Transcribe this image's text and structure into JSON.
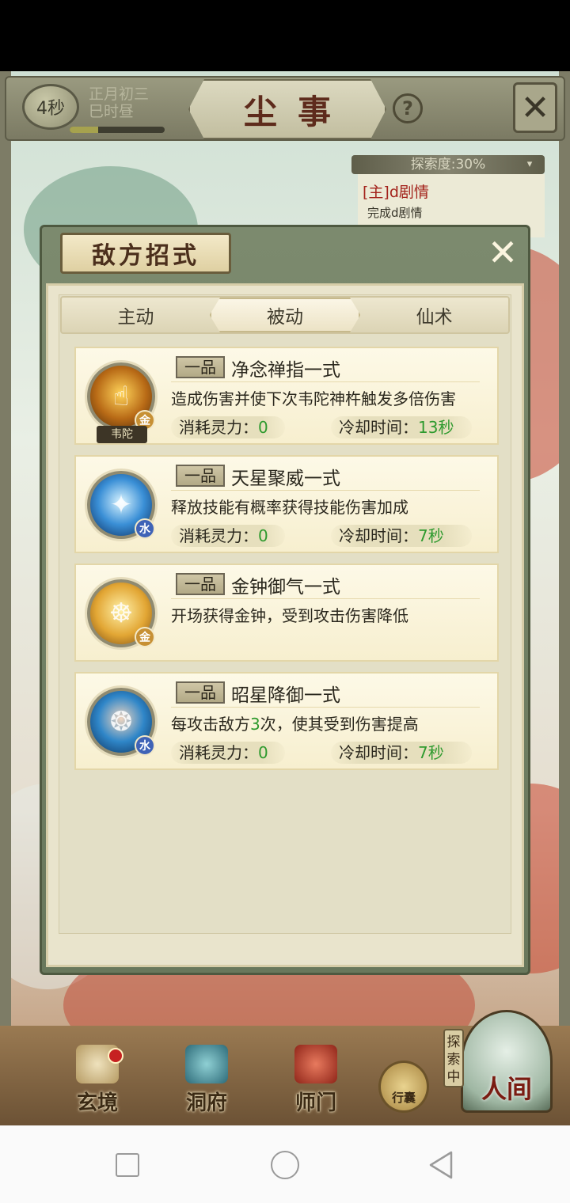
{
  "header": {
    "timer": "4秒",
    "date_line1": "正月初三",
    "date_line2": "巳时昼",
    "title": "尘事",
    "help_label": "?",
    "close_label": "✕",
    "time_progress": 0.3
  },
  "explore": {
    "progress_label": "探索度:30%",
    "quest_title": "[主]d剧情",
    "quest_desc": "完成d剧情"
  },
  "dialog": {
    "title": "敌方招式",
    "close_label": "✕",
    "tabs": [
      {
        "label": "主动",
        "active": false
      },
      {
        "label": "被动",
        "active": true
      },
      {
        "label": "仙术",
        "active": false
      }
    ]
  },
  "labels": {
    "mana": "消耗灵力：",
    "cooldown": "冷却时间："
  },
  "skills": [
    {
      "grade": "一品",
      "name": "净念禅指一式",
      "desc": "造成伤害并使下次韦陀神杵触发多倍",
      "desc_overflow": "伤害",
      "element": "金",
      "icon": "finger-strike-icon",
      "caption": "韦陀",
      "mana": "0",
      "cooldown": "13秒"
    },
    {
      "grade": "一品",
      "name": "天星聚威一式",
      "desc": "释放技能有概率获得技能伤害加成",
      "element": "水",
      "icon": "star-beam-icon",
      "mana": "0",
      "cooldown": "7秒"
    },
    {
      "grade": "一品",
      "name": "金钟御气一式",
      "desc": "开场获得金钟，受到攻击伤害降低",
      "element": "金",
      "icon": "golden-bell-icon"
    },
    {
      "grade": "一品",
      "name": "昭星降御一式",
      "desc_prefix": "每攻击敌方",
      "desc_num": "3",
      "desc_suffix": "次，使其受到伤害提高",
      "element": "水",
      "icon": "star-foot-icon",
      "mana": "0",
      "cooldown": "7秒"
    }
  ],
  "bottom_nav": {
    "items": [
      "玄境",
      "洞府",
      "师门"
    ],
    "bag_label": "行囊",
    "explore_tag": "探索中",
    "world_label": "人间"
  }
}
